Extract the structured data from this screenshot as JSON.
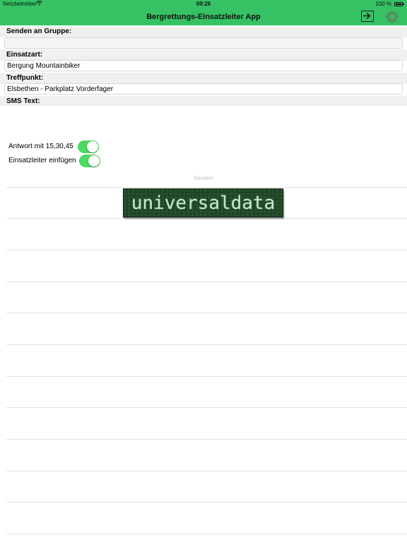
{
  "status_bar": {
    "carrier": "Netzbetreiber",
    "time": "09:26",
    "battery": "100 %"
  },
  "nav": {
    "title": "Bergrettungs-Einsatzleiter App",
    "bar_color": "#36c264"
  },
  "form": {
    "group_label": "Senden an Gruppe:",
    "group_value": "",
    "type_label": "Einsatzart:",
    "type_value": "Bergung Mountainbiker",
    "meeting_label": "Treffpunkt:",
    "meeting_value": "Elsbethen - Parkplatz Vorderfager",
    "sms_label": "SMS Text:",
    "sms_value": ""
  },
  "switches": [
    {
      "label": "Antwort mit 15,30,45",
      "on": true
    },
    {
      "label": "Einsatzleiter einfügen",
      "on": true
    }
  ],
  "toggle_color": "#4cd964",
  "send_label": "Senden",
  "logo_text": "universaldata"
}
